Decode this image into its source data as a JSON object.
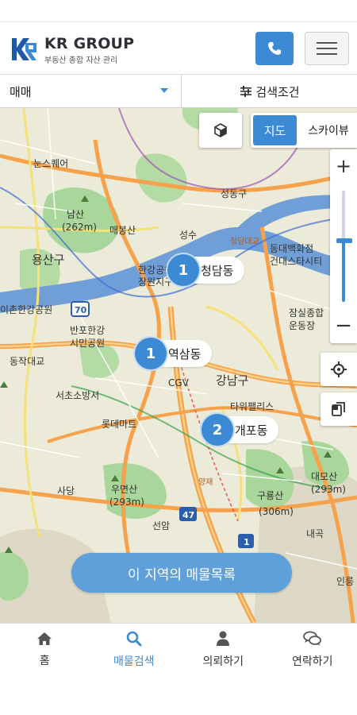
{
  "header": {
    "brand": "KR GROUP",
    "tagline": "부동산 종합 자산 관리"
  },
  "filters": {
    "trade_type": "매매",
    "search_condition": "검색조건"
  },
  "map": {
    "view_toggle": {
      "map": "지도",
      "skyview": "스카이뷰",
      "selected": "지도"
    },
    "zoom": {
      "in": "+",
      "out": "−",
      "level_fraction": 0.55
    },
    "clusters": [
      {
        "count": "1",
        "label": "청담동"
      },
      {
        "count": "1",
        "label": "역삼동"
      },
      {
        "count": "2",
        "label": "개포동"
      }
    ],
    "labels": [
      "성동구",
      "남산",
      "(262m)",
      "매봉산",
      "용산구",
      "한강공원",
      "장원지구",
      "성수",
      "동대백화점",
      "건대스타시티",
      "청담대교",
      "잠실종합",
      "운동장",
      "반포한강",
      "시민공원",
      "동작대교",
      "서초소방서",
      "강남구",
      "CGV",
      "타워팰리스",
      "롯데마트",
      "우면산",
      "(293m)",
      "사당",
      "선암",
      "구룡산",
      "(306m)",
      "대모산",
      "(293m)",
      "내곡",
      "인릉",
      "눈스퀘어",
      "이촌한강공원",
      "양재",
      "47",
      "1",
      "70"
    ],
    "list_button": "이 지역의 매물목록",
    "colors": {
      "accent": "#3b8ad3",
      "river": "#6f9fd6",
      "park": "#a9d69a",
      "road": "#f6a24c"
    }
  },
  "tabs": [
    {
      "label": "홈",
      "icon": "home-icon",
      "active": false
    },
    {
      "label": "매물검색",
      "icon": "search-icon",
      "active": true
    },
    {
      "label": "의뢰하기",
      "icon": "person-icon",
      "active": false
    },
    {
      "label": "연락하기",
      "icon": "chat-icon",
      "active": false
    }
  ]
}
